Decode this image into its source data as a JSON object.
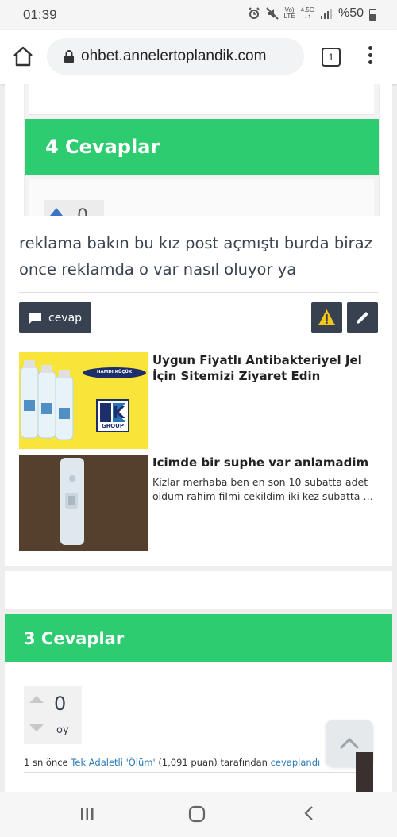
{
  "status_bar": {
    "time": "01:39",
    "network_label_top": "Vo)",
    "network_label_bottom": "LTE",
    "signal_label_top": "4.5G",
    "battery": "%50"
  },
  "browser": {
    "url": "ohbet.annelertoplandik.com",
    "tab_count": "1"
  },
  "embedded_header": {
    "answers_title": "4 Cevaplar",
    "vote_count": "0"
  },
  "post": {
    "text": "reklama bakın bu kız post açmıştı burda biraz once reklamda o var nasıl oluyor ya",
    "reply_label": "cevap"
  },
  "ads": [
    {
      "title": "Uygun Fiyatlı Antibakteriyel Jel İçin Sitemizi Ziyaret Edin",
      "description_1": "",
      "description_2": "",
      "logo_text_1": "HAMDI KÜÇÜK",
      "logo_text_2": "HK",
      "logo_text_3": "GROUP"
    },
    {
      "title": "Icimde bir suphe var anlamadim",
      "description_1": "Kizlar merhaba ben en son 10 subatta adet",
      "description_2": "oldum rahim filmi cekildim iki kez subatta bi..."
    }
  ],
  "answers": {
    "title": "3 Cevaplar",
    "vote_count": "0",
    "vote_unit": "oy",
    "meta_prefix": "1 sn önce",
    "author": "Tek Adaletli 'Ölüm'",
    "points": "(1,091 puan)",
    "by": "tarafından",
    "action": "cevaplandı"
  },
  "colors": {
    "green": "#2ecc71",
    "dark_button": "#37414f",
    "link": "#2a7ab8",
    "warn_yellow": "#f5c518"
  },
  "icons": {
    "home": "home-icon",
    "lock": "lock-icon",
    "menu": "more-vert-icon",
    "reply": "comment-icon",
    "warn": "warning-icon",
    "edit": "pencil-icon",
    "scroll": "chevron-up-icon"
  }
}
